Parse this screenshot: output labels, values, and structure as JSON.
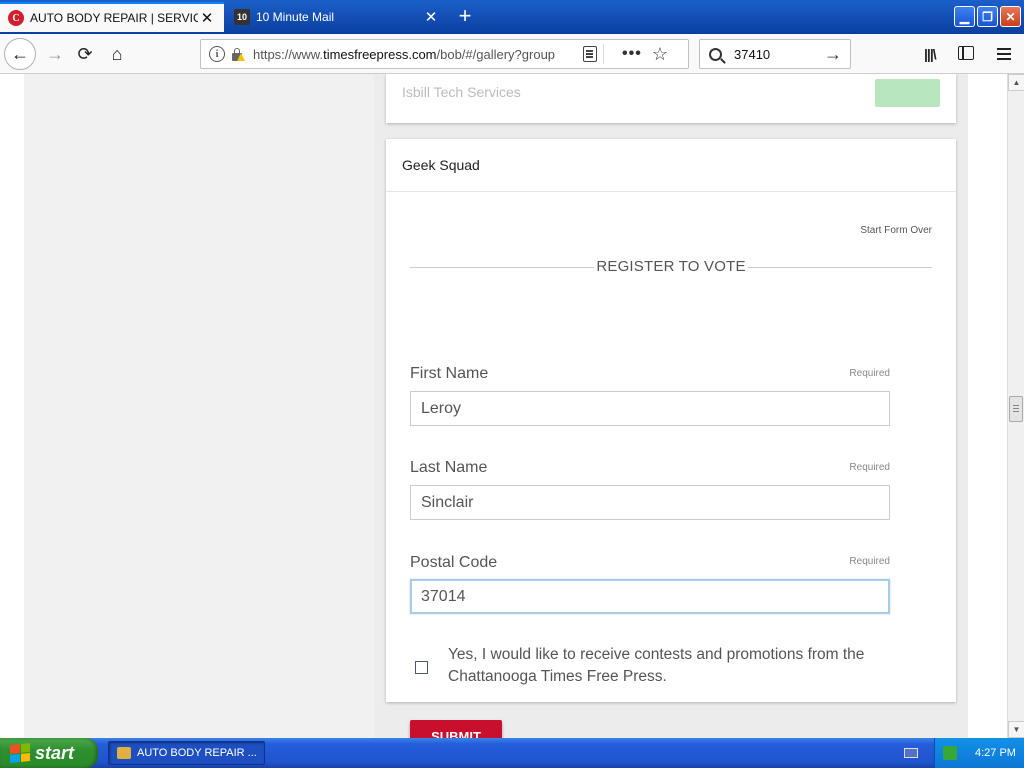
{
  "tabs": [
    {
      "favicon": "C",
      "title": "AUTO BODY REPAIR | SERVICES",
      "close": "✕",
      "active": true
    },
    {
      "favicon": "10",
      "title": "10 Minute Mail",
      "close": "✕",
      "active": false
    }
  ],
  "window_controls": {
    "new_tab": "+"
  },
  "navigation": {
    "url_prefix": "https://www.",
    "url_host": "timesfreepress.com",
    "url_path": "/bob/#/gallery?group",
    "search_value": "37410"
  },
  "page": {
    "previous_card_title": "Isbill Tech Services",
    "card_title": "Geek Squad",
    "start_over": "Start Form Over",
    "section_title": "REGISTER TO VOTE",
    "fields": [
      {
        "label": "First Name",
        "required": "Required",
        "value": "Leroy"
      },
      {
        "label": "Last Name",
        "required": "Required",
        "value": "Sinclair"
      },
      {
        "label": "Postal Code",
        "required": "Required",
        "value": "37014"
      }
    ],
    "checkbox_label": "Yes, I would like to receive contests and promotions from the Chattanooga Times Free Press.",
    "submit": "SUBMIT"
  },
  "taskbar": {
    "start": "start",
    "task": "AUTO BODY REPAIR ...",
    "clock": "4:27 PM"
  },
  "colors": {
    "submit_bg": "#c8102e",
    "focus_border": "#a8cce6",
    "prev_button": "#b8e6bf"
  }
}
